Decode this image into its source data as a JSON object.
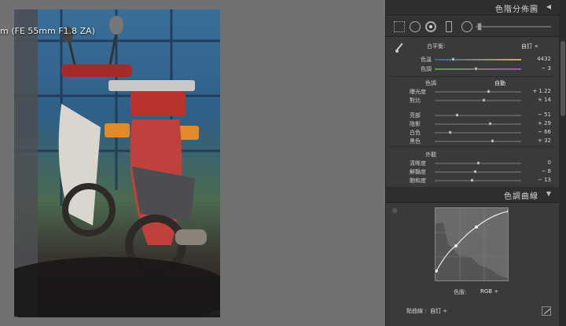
{
  "lens_label": "m (FE 55mm F1.8 ZA)",
  "sections": {
    "histogram_title": "色階分佈圖",
    "curve_title": "色調曲線"
  },
  "white_balance": {
    "label": "白平衡:",
    "preset": "自訂 ÷",
    "temp_label": "色溫",
    "temp_value": "4432",
    "tint_label": "色調",
    "tint_value": "− 3"
  },
  "tone": {
    "label": "色調",
    "auto": "自動",
    "rows": [
      {
        "label": "曝光度",
        "value": "+ 1.22",
        "pos": 0.62
      },
      {
        "label": "對比",
        "value": "+ 14",
        "pos": 0.56
      },
      {
        "label": "亮部",
        "value": "− 51",
        "pos": 0.25
      },
      {
        "label": "陰影",
        "value": "+ 29",
        "pos": 0.64
      },
      {
        "label": "白色",
        "value": "− 66",
        "pos": 0.17
      },
      {
        "label": "黑色",
        "value": "+ 32",
        "pos": 0.66
      }
    ]
  },
  "presence": {
    "label": "外觀",
    "rows": [
      {
        "label": "清晰度",
        "value": "0",
        "pos": 0.5
      },
      {
        "label": "鮮豔度",
        "value": "− 8",
        "pos": 0.46
      },
      {
        "label": "飽和度",
        "value": "− 13",
        "pos": 0.43
      }
    ]
  },
  "curve": {
    "channel_label": "色版:",
    "channel_value": "RGB ÷",
    "point_curve_label": "點曲線 :",
    "point_curve_value": "自訂 ÷"
  },
  "icons": {
    "eyedropper": "eyedropper-icon",
    "target_adjust": "target-adjust-icon",
    "collapse": "triangle-down-icon"
  }
}
